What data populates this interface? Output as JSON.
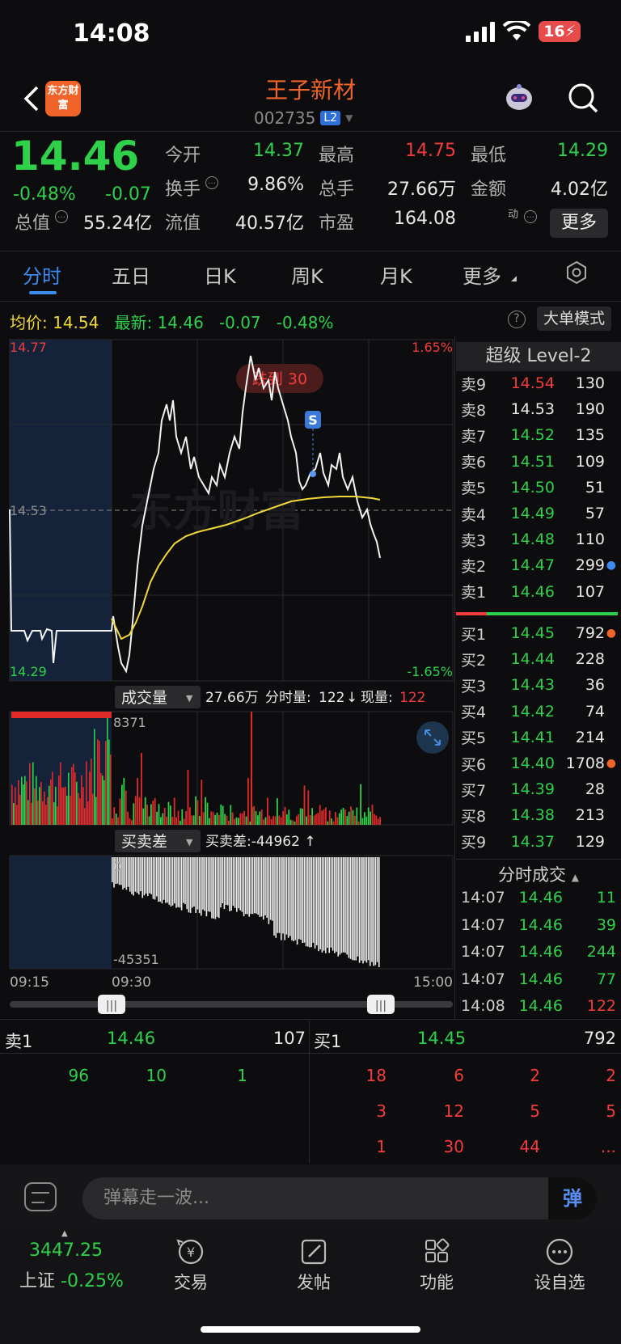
{
  "status": {
    "time": "14:08",
    "battery": "16"
  },
  "header": {
    "stock_name": "王子新材",
    "stock_code": "002735",
    "badge": "L2",
    "logo_text": "东方财富"
  },
  "quote": {
    "price": "14.46",
    "change_pct": "-0.48%",
    "change_abs": "-0.07",
    "stats": [
      {
        "label": "今开",
        "value": "14.37",
        "color": "green"
      },
      {
        "label": "最高",
        "value": "14.75",
        "color": "red"
      },
      {
        "label": "最低",
        "value": "14.29",
        "color": "green"
      },
      {
        "label": "换手",
        "value": "9.86%",
        "color": "white"
      },
      {
        "label": "总手",
        "value": "27.66万",
        "color": "white"
      },
      {
        "label": "金额",
        "value": "4.02亿",
        "color": "white"
      },
      {
        "label": "总值",
        "value": "55.24亿",
        "color": "white"
      },
      {
        "label": "流值",
        "value": "40.57亿",
        "color": "white"
      },
      {
        "label": "市盈",
        "superscript": "动",
        "value": "164.08",
        "color": "white"
      }
    ],
    "more_label": "更多"
  },
  "tabs": [
    "分时",
    "五日",
    "日K",
    "周K",
    "月K",
    "更多"
  ],
  "avg_row": {
    "avg_label": "均价:",
    "avg_value": "14.54",
    "latest_label": "最新:",
    "latest_value": "14.46",
    "latest_change": "-0.07",
    "latest_pct": "-0.48%",
    "big_order_mode": "大单模式",
    "help": "?"
  },
  "chart_data": {
    "type": "line",
    "price_axis": {
      "top": "14.77",
      "mid": "14.53",
      "bottom": "14.29",
      "top_pct": "1.65%",
      "bottom_pct": "-1.65%"
    },
    "alert_label": "跌到 30",
    "signal_marker": "S",
    "watermark": "东方财富",
    "volume_label": "成交量",
    "volume_info": {
      "total": "27.66万",
      "minute_label": "分时量:",
      "minute_value": "122",
      "arrow": "↓",
      "now_label": "现量:",
      "now_value": "122"
    },
    "volume_max": "8371",
    "diff_label": "买卖差",
    "diff_info": "买卖差:-44962 ↑",
    "diff_top": "0",
    "diff_bottom": "-45351",
    "time_axis": [
      "09:15",
      "09:30",
      "15:00"
    ]
  },
  "level2": {
    "title": "超级 Level-2",
    "asks": [
      {
        "label": "卖9",
        "price": "14.54",
        "qty": "130",
        "color": "red",
        "dot": ""
      },
      {
        "label": "卖8",
        "price": "14.53",
        "qty": "190",
        "color": "white",
        "dot": ""
      },
      {
        "label": "卖7",
        "price": "14.52",
        "qty": "135",
        "color": "green",
        "dot": ""
      },
      {
        "label": "卖6",
        "price": "14.51",
        "qty": "109",
        "color": "green",
        "dot": ""
      },
      {
        "label": "卖5",
        "price": "14.50",
        "qty": "51",
        "color": "green",
        "dot": ""
      },
      {
        "label": "卖4",
        "price": "14.49",
        "qty": "57",
        "color": "green",
        "dot": ""
      },
      {
        "label": "卖3",
        "price": "14.48",
        "qty": "110",
        "color": "green",
        "dot": ""
      },
      {
        "label": "卖2",
        "price": "14.47",
        "qty": "299",
        "color": "green",
        "dot": "blue"
      },
      {
        "label": "卖1",
        "price": "14.46",
        "qty": "107",
        "color": "green",
        "dot": ""
      }
    ],
    "bids": [
      {
        "label": "买1",
        "price": "14.45",
        "qty": "792",
        "color": "green",
        "dot": "orange"
      },
      {
        "label": "买2",
        "price": "14.44",
        "qty": "228",
        "color": "green",
        "dot": ""
      },
      {
        "label": "买3",
        "price": "14.43",
        "qty": "36",
        "color": "green",
        "dot": ""
      },
      {
        "label": "买4",
        "price": "14.42",
        "qty": "74",
        "color": "green",
        "dot": ""
      },
      {
        "label": "买5",
        "price": "14.41",
        "qty": "214",
        "color": "green",
        "dot": ""
      },
      {
        "label": "买6",
        "price": "14.40",
        "qty": "1708",
        "color": "green",
        "dot": "orange"
      },
      {
        "label": "买7",
        "price": "14.39",
        "qty": "28",
        "color": "green",
        "dot": ""
      },
      {
        "label": "买8",
        "price": "14.38",
        "qty": "213",
        "color": "green",
        "dot": ""
      },
      {
        "label": "买9",
        "price": "14.37",
        "qty": "129",
        "color": "green",
        "dot": ""
      }
    ],
    "ticks_title": "分时成交",
    "ticks": [
      {
        "time": "14:07",
        "price": "14.46",
        "vol": "11",
        "color": "green"
      },
      {
        "time": "14:07",
        "price": "14.46",
        "vol": "39",
        "color": "green"
      },
      {
        "time": "14:07",
        "price": "14.46",
        "vol": "244",
        "color": "green"
      },
      {
        "time": "14:07",
        "price": "14.46",
        "vol": "77",
        "color": "green"
      },
      {
        "time": "14:08",
        "price": "14.46",
        "vol": "122",
        "color": "red"
      }
    ]
  },
  "queue": {
    "sell_label": "卖1",
    "sell_price": "14.46",
    "sell_qty": "107",
    "buy_label": "买1",
    "buy_price": "14.45",
    "buy_qty": "792",
    "sell_orders": [
      "96",
      "10",
      "1"
    ],
    "buy_orders": [
      [
        "18",
        "6",
        "2",
        "2"
      ],
      [
        "3",
        "12",
        "5",
        "5"
      ],
      [
        "1",
        "30",
        "44",
        "..."
      ]
    ]
  },
  "danmaku": {
    "placeholder": "弹幕走一波...",
    "send": "弹"
  },
  "tabbar": {
    "index_value": "3447.25",
    "index_name": "上证",
    "index_pct": "-0.25%",
    "items": [
      {
        "label": "交易",
        "icon": "trade-icon"
      },
      {
        "label": "发帖",
        "icon": "post-icon"
      },
      {
        "label": "功能",
        "icon": "functions-icon"
      },
      {
        "label": "设自选",
        "icon": "add-watchlist-icon"
      }
    ]
  }
}
